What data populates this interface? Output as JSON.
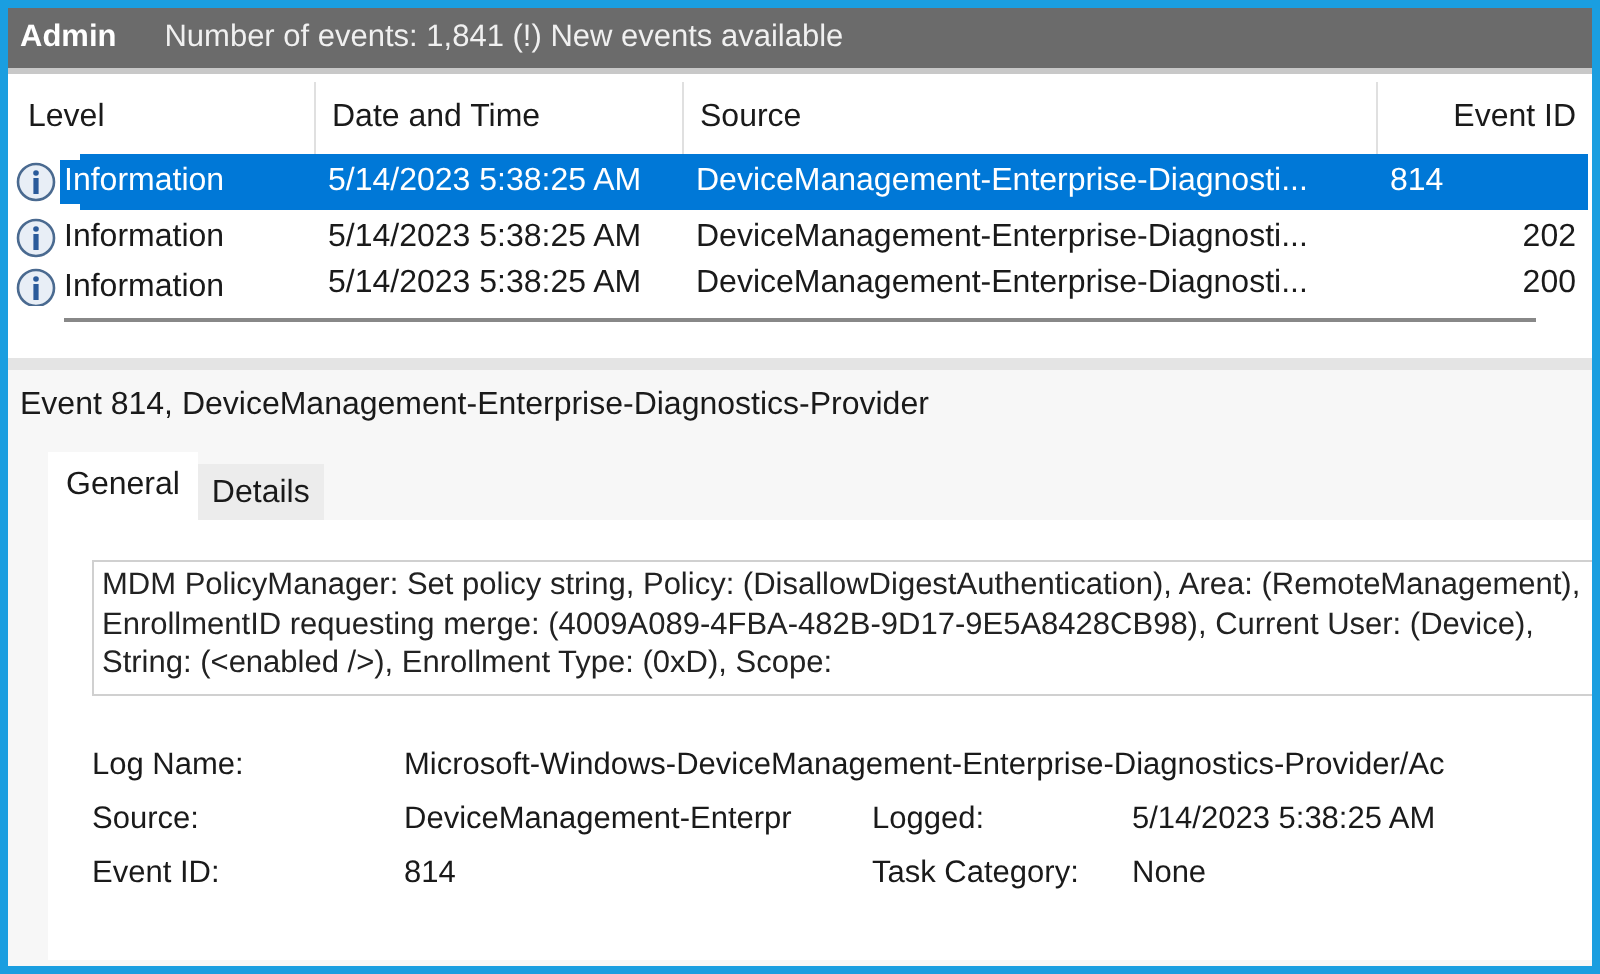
{
  "header": {
    "title": "Admin",
    "summary": "Number of events: 1,841 (!) New events available"
  },
  "table": {
    "columns": [
      "Level",
      "Date and Time",
      "Source",
      "Event ID"
    ],
    "rows": [
      {
        "level": "Information",
        "date": "5/14/2023 5:38:25 AM",
        "source": "DeviceManagement-Enterprise-Diagnosti...",
        "event_id": "814",
        "selected": true
      },
      {
        "level": "Information",
        "date": "5/14/2023 5:38:25 AM",
        "source": "DeviceManagement-Enterprise-Diagnosti...",
        "event_id": "202",
        "selected": false
      },
      {
        "level": "Information",
        "date": "5/14/2023 5:38:25 AM",
        "source": "DeviceManagement-Enterprise-Diagnosti...",
        "event_id": "200",
        "selected": false
      }
    ]
  },
  "details": {
    "title": "Event 814, DeviceManagement-Enterprise-Diagnostics-Provider",
    "tabs": [
      {
        "label": "General",
        "selected": true
      },
      {
        "label": "Details",
        "selected": false
      }
    ],
    "message": "MDM PolicyManager: Set policy string, Policy: (DisallowDigestAuthentication), Area: (RemoteManagement), EnrollmentID requesting merge: (4009A089-4FBA-482B-9D17-9E5A8428CB98), Current User: (Device), String: (<enabled />), Enrollment Type: (0xD), Scope:",
    "fields": [
      {
        "label": "Log Name:",
        "value": "Microsoft-Windows-DeviceManagement-Enterprise-Diagnostics-Provider/Ac"
      },
      {
        "label": "Source:",
        "value": "DeviceManagement-Enterpr",
        "label_2": "Logged:",
        "value_2": "5/14/2023 5:38:25 AM"
      },
      {
        "label": "Event ID:",
        "value": "814",
        "label_2": "Task Category:",
        "value_2": "None"
      }
    ]
  }
}
